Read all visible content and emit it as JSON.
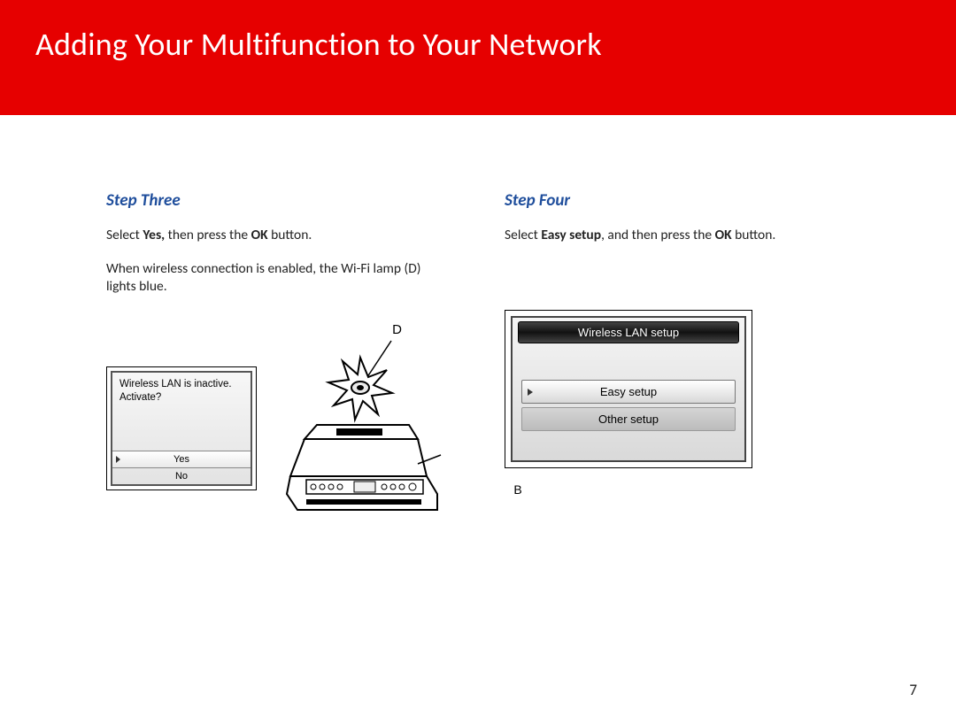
{
  "header": {
    "title": "Adding Your Multifunction to Your Network"
  },
  "left": {
    "step_title": "Step Three",
    "para1_pre": "Select ",
    "para1_b1": "Yes,",
    "para1_mid": " then press the ",
    "para1_b2": "OK",
    "para1_post": " button.",
    "para2": "When wireless connection is enabled, the Wi-Fi lamp (D) lights blue.",
    "screen1": {
      "line1": "Wireless LAN is inactive.",
      "line2": "Activate?",
      "opt_yes": "Yes",
      "opt_no": "No"
    },
    "label_d": "D",
    "label_b": "B"
  },
  "right": {
    "step_title": "Step Four",
    "para1_pre": "Select ",
    "para1_b1": "Easy setup",
    "para1_mid": ", and then press the ",
    "para1_b2": "OK",
    "para1_post": " button.",
    "screen2": {
      "title": "Wireless LAN setup",
      "opt_easy": "Easy setup",
      "opt_other": "Other setup"
    }
  },
  "page_number": "7"
}
